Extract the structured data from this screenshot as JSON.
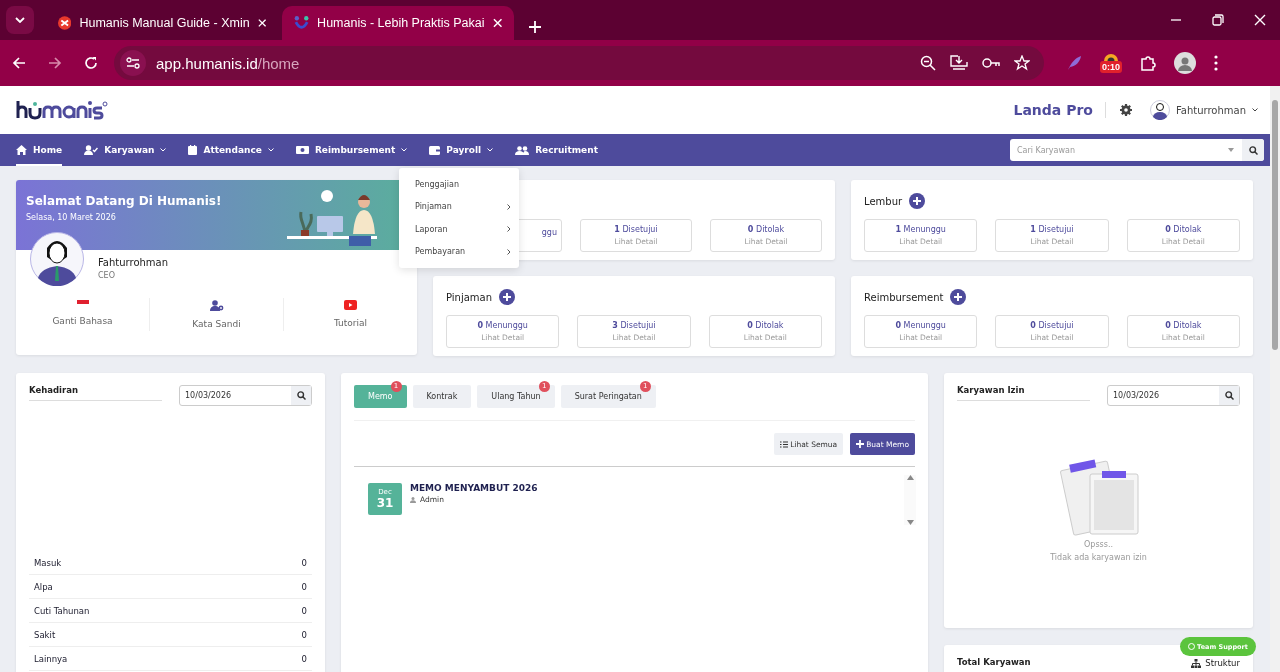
{
  "browser": {
    "tabs": [
      {
        "title": "Humanis Manual Guide - Xmin",
        "selected": false
      },
      {
        "title": "Humanis - Lebih Praktis Pakai",
        "selected": true
      }
    ],
    "url": {
      "host": "app.humanis.id",
      "path": "/home"
    },
    "extension_badge": "0:10"
  },
  "header": {
    "brand": "Landa Pro",
    "user": "Fahturrohman"
  },
  "nav": {
    "items": [
      {
        "label": "Home",
        "selected": true,
        "caret": false
      },
      {
        "label": "Karyawan",
        "selected": false,
        "caret": true
      },
      {
        "label": "Attendance",
        "selected": false,
        "caret": true
      },
      {
        "label": "Reimbursement",
        "selected": false,
        "caret": true
      },
      {
        "label": "Payroll",
        "selected": false,
        "caret": true
      },
      {
        "label": "Recruitment",
        "selected": false,
        "caret": false
      }
    ],
    "search_placeholder": "Cari Karyawan"
  },
  "dropdown": [
    {
      "label": "Penggajian",
      "submenu": false
    },
    {
      "label": "Pinjaman",
      "submenu": true
    },
    {
      "label": "Laporan",
      "submenu": true
    },
    {
      "label": "Pembayaran",
      "submenu": true
    }
  ],
  "welcome": {
    "title": "Selamat Datang Di Humanis!",
    "date": "Selasa, 10 Maret 2026",
    "name": "Fahturrohman",
    "role": "CEO",
    "actions": [
      {
        "label": "Ganti Bahasa",
        "kind": "flag"
      },
      {
        "label": "Kata Sandi",
        "kind": "user"
      },
      {
        "label": "Tutorial",
        "kind": "youtube"
      }
    ]
  },
  "stat_columns": [
    [
      {
        "items": [
          {
            "kind": "partial",
            "text": "ggu"
          },
          {
            "kind": "full",
            "text": "**1** Disetujui",
            "sub": "Lihat Detail"
          },
          {
            "kind": "full",
            "text": "**0** Ditolak",
            "sub": "Lihat Detail"
          }
        ]
      },
      {
        "title": "Pinjaman",
        "items": [
          {
            "kind": "full",
            "text": "**0** Menunggu",
            "sub": "Lihat Detail"
          },
          {
            "kind": "full",
            "text": "**3** Disetujui",
            "sub": "Lihat Detail"
          },
          {
            "kind": "full",
            "text": "**0** Ditolak",
            "sub": "Lihat Detail"
          }
        ]
      }
    ],
    [
      {
        "title": "Lembur",
        "items": [
          {
            "kind": "full",
            "text": "**1** Menunggu",
            "sub": "Lihat Detail"
          },
          {
            "kind": "full",
            "text": "**1** Disetujui",
            "sub": "Lihat Detail"
          },
          {
            "kind": "full",
            "text": "**0** Ditolak",
            "sub": "Lihat Detail"
          }
        ]
      },
      {
        "title": "Reimbursement",
        "items": [
          {
            "kind": "full",
            "text": "**0** Menunggu",
            "sub": "Lihat Detail"
          },
          {
            "kind": "full",
            "text": "**0** Disetujui",
            "sub": "Lihat Detail"
          },
          {
            "kind": "full",
            "text": "**0** Ditolak",
            "sub": "Lihat Detail"
          }
        ]
      }
    ]
  ],
  "kehadiran": {
    "title": "Kehadiran",
    "date": "10/03/2026",
    "rows": [
      {
        "label": "Masuk",
        "value": "0"
      },
      {
        "label": "Alpa",
        "value": "0"
      },
      {
        "label": "Cuti Tahunan",
        "value": "0"
      },
      {
        "label": "Sakit",
        "value": "0"
      },
      {
        "label": "Lainnya",
        "value": "0"
      }
    ]
  },
  "memo": {
    "tabs": [
      {
        "label": "Memo",
        "badge": "1",
        "selected": true
      },
      {
        "label": "Kontrak",
        "selected": false
      },
      {
        "label": "Ulang Tahun",
        "badge": "1",
        "selected": false
      },
      {
        "label": "Surat Peringatan",
        "badge": "1",
        "selected": false
      }
    ],
    "view_all": "Lihat Semua",
    "create": "Buat Memo",
    "items": [
      {
        "month": "Dec",
        "day": "31",
        "title": "MEMO MENYAMBUT 2026",
        "author": "Admin"
      }
    ]
  },
  "izin": {
    "title": "Karyawan Izin",
    "date": "10/03/2026",
    "empty_title": "Opsss..",
    "empty_text": "Tidak ada karyawan izin"
  },
  "total": {
    "title": "Total Karyawan",
    "link": "Struktur"
  },
  "support": "Team Support"
}
